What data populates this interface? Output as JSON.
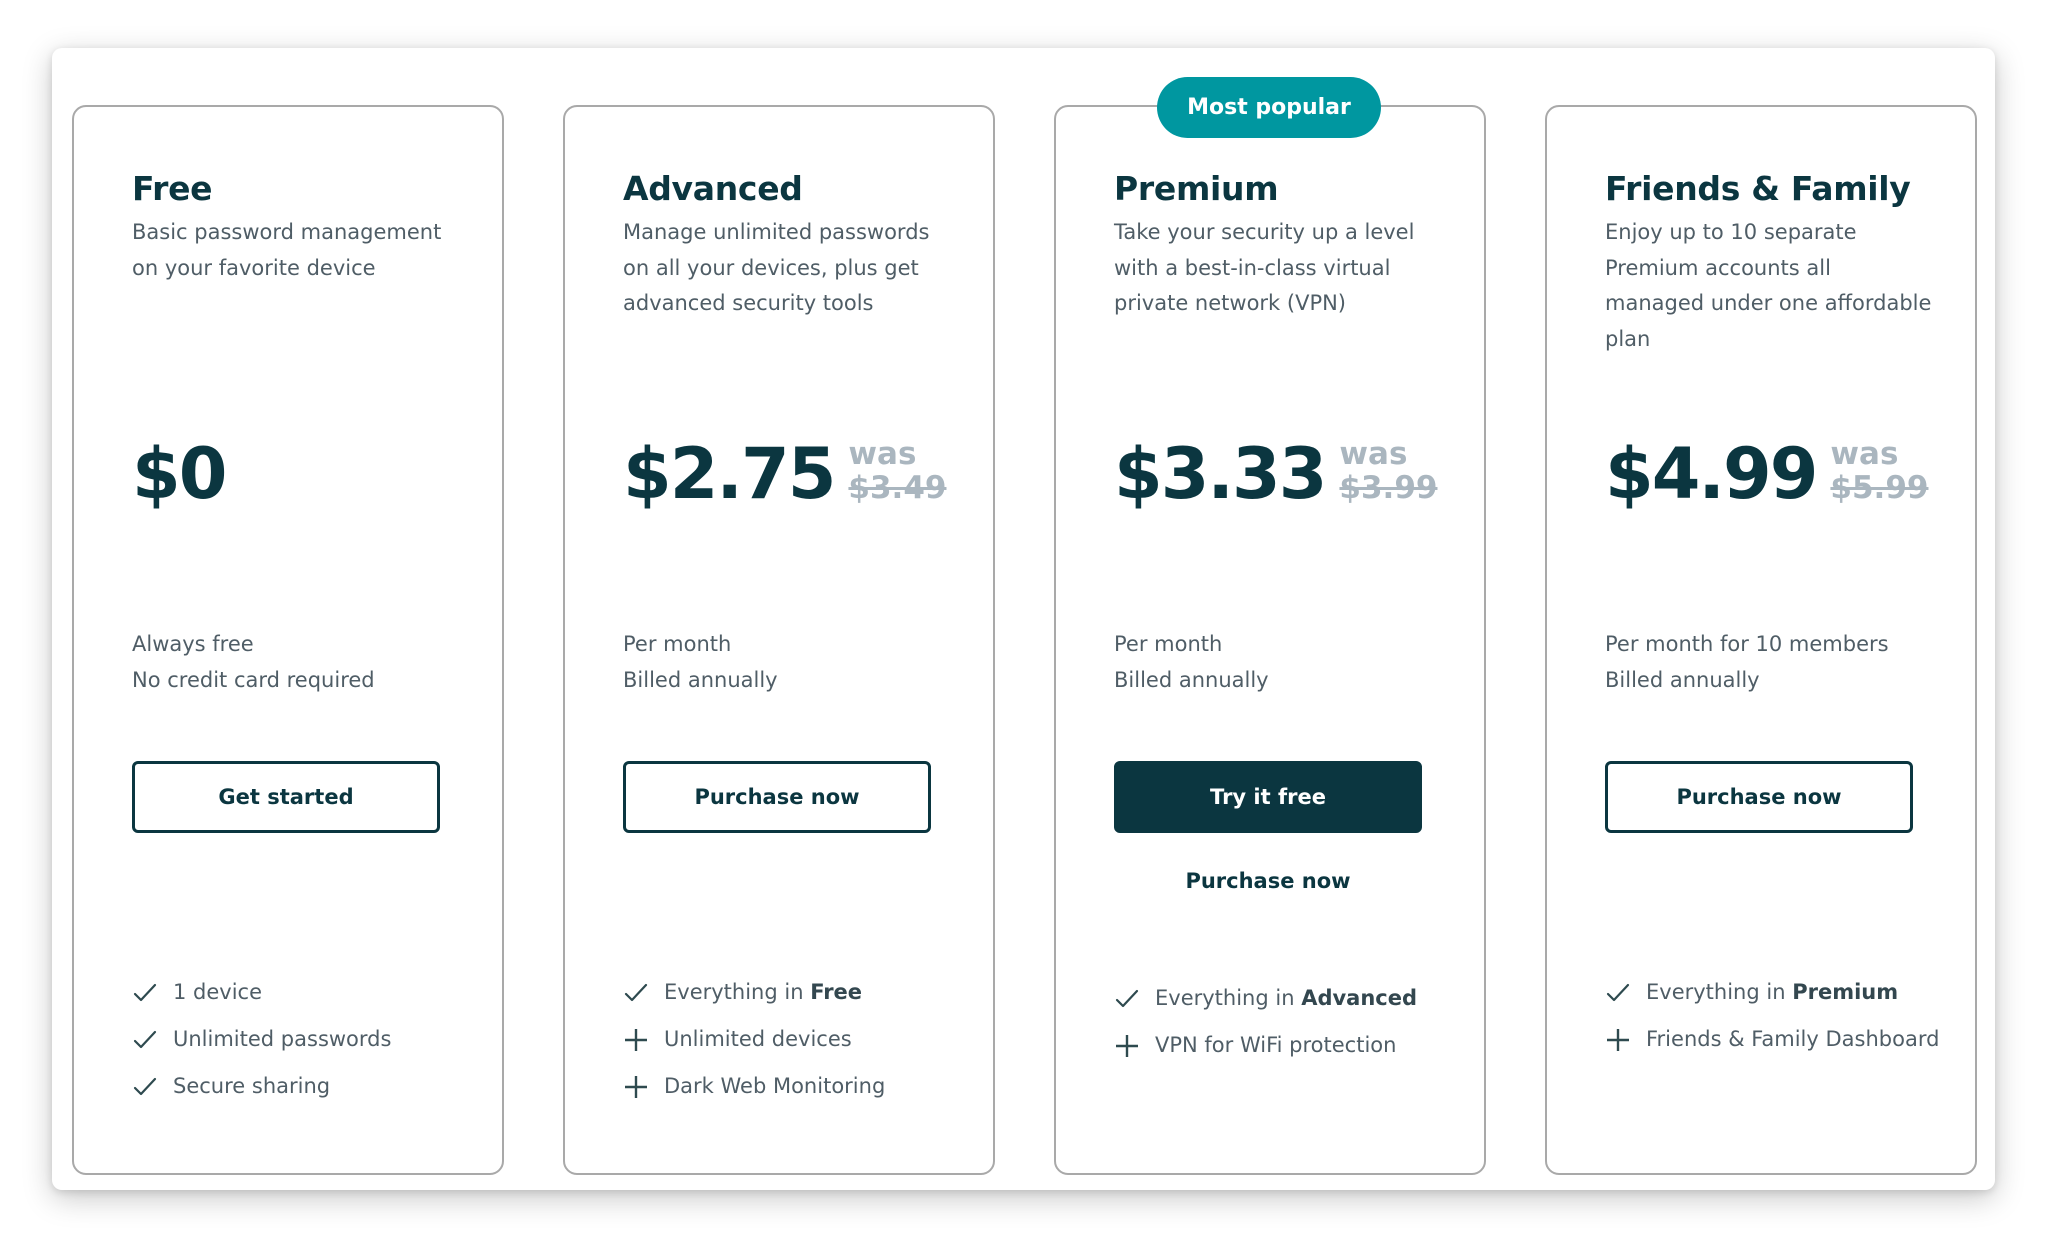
{
  "badge": "Most popular",
  "colors": {
    "primary": "#0b3640",
    "accent": "#0097a0",
    "muted_text": "#4f5d66",
    "strikethrough": "#aab6bf",
    "card_border": "#a9a9a9"
  },
  "plans": [
    {
      "name": "Free",
      "description": "Basic password management on your favorite device",
      "price": "$0",
      "was_label": "",
      "old_price": "",
      "sub_line1": "Always free",
      "sub_line2": "No credit card required",
      "button": "Get started",
      "link": "",
      "features": [
        {
          "icon": "check-icon",
          "text": "1 device",
          "bold": ""
        },
        {
          "icon": "check-icon",
          "text": "Unlimited passwords",
          "bold": ""
        },
        {
          "icon": "check-icon",
          "text": "Secure sharing",
          "bold": ""
        }
      ]
    },
    {
      "name": "Advanced",
      "description": "Manage unlimited passwords on all your devices, plus get advanced security tools",
      "price": "$2.75",
      "was_label": "was",
      "old_price": "$3.49",
      "sub_line1": "Per month",
      "sub_line2": "Billed annually",
      "button": "Purchase now",
      "link": "",
      "features": [
        {
          "icon": "check-icon",
          "text": "Everything in ",
          "bold": "Free"
        },
        {
          "icon": "plus-icon",
          "text": "Unlimited devices",
          "bold": ""
        },
        {
          "icon": "plus-icon",
          "text": "Dark Web Monitoring",
          "bold": ""
        }
      ]
    },
    {
      "name": "Premium",
      "description": "Take your security up a level with a best-in-class virtual private network (VPN)",
      "price": "$3.33",
      "was_label": "was",
      "old_price": "$3.99",
      "sub_line1": "Per month",
      "sub_line2": "Billed annually",
      "button": "Try it free",
      "link": "Purchase now",
      "features": [
        {
          "icon": "check-icon",
          "text": "Everything in ",
          "bold": "Advanced"
        },
        {
          "icon": "plus-icon",
          "text": "VPN for WiFi protection",
          "bold": ""
        }
      ]
    },
    {
      "name": "Friends & Family",
      "description": "Enjoy up to 10 separate Premium accounts all managed under one affordable plan",
      "price": "$4.99",
      "was_label": "was",
      "old_price": "$5.99",
      "sub_line1": "Per month for 10 members",
      "sub_line2": "Billed annually",
      "button": "Purchase now",
      "link": "",
      "features": [
        {
          "icon": "check-icon",
          "text": "Everything in ",
          "bold": "Premium"
        },
        {
          "icon": "plus-icon",
          "text": "Friends & Family Dashboard",
          "bold": ""
        }
      ]
    }
  ]
}
